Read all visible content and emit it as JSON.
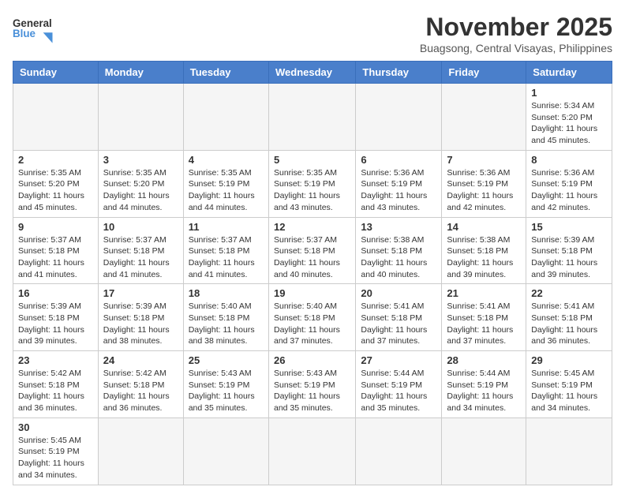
{
  "header": {
    "logo_general": "General",
    "logo_blue": "Blue",
    "month_title": "November 2025",
    "location": "Buagsong, Central Visayas, Philippines"
  },
  "weekdays": [
    "Sunday",
    "Monday",
    "Tuesday",
    "Wednesday",
    "Thursday",
    "Friday",
    "Saturday"
  ],
  "days": [
    {
      "num": "",
      "info": ""
    },
    {
      "num": "",
      "info": ""
    },
    {
      "num": "",
      "info": ""
    },
    {
      "num": "",
      "info": ""
    },
    {
      "num": "",
      "info": ""
    },
    {
      "num": "",
      "info": ""
    },
    {
      "num": "1",
      "info": "Sunrise: 5:34 AM\nSunset: 5:20 PM\nDaylight: 11 hours\nand 45 minutes."
    },
    {
      "num": "2",
      "info": "Sunrise: 5:35 AM\nSunset: 5:20 PM\nDaylight: 11 hours\nand 45 minutes."
    },
    {
      "num": "3",
      "info": "Sunrise: 5:35 AM\nSunset: 5:20 PM\nDaylight: 11 hours\nand 44 minutes."
    },
    {
      "num": "4",
      "info": "Sunrise: 5:35 AM\nSunset: 5:19 PM\nDaylight: 11 hours\nand 44 minutes."
    },
    {
      "num": "5",
      "info": "Sunrise: 5:35 AM\nSunset: 5:19 PM\nDaylight: 11 hours\nand 43 minutes."
    },
    {
      "num": "6",
      "info": "Sunrise: 5:36 AM\nSunset: 5:19 PM\nDaylight: 11 hours\nand 43 minutes."
    },
    {
      "num": "7",
      "info": "Sunrise: 5:36 AM\nSunset: 5:19 PM\nDaylight: 11 hours\nand 42 minutes."
    },
    {
      "num": "8",
      "info": "Sunrise: 5:36 AM\nSunset: 5:19 PM\nDaylight: 11 hours\nand 42 minutes."
    },
    {
      "num": "9",
      "info": "Sunrise: 5:37 AM\nSunset: 5:18 PM\nDaylight: 11 hours\nand 41 minutes."
    },
    {
      "num": "10",
      "info": "Sunrise: 5:37 AM\nSunset: 5:18 PM\nDaylight: 11 hours\nand 41 minutes."
    },
    {
      "num": "11",
      "info": "Sunrise: 5:37 AM\nSunset: 5:18 PM\nDaylight: 11 hours\nand 41 minutes."
    },
    {
      "num": "12",
      "info": "Sunrise: 5:37 AM\nSunset: 5:18 PM\nDaylight: 11 hours\nand 40 minutes."
    },
    {
      "num": "13",
      "info": "Sunrise: 5:38 AM\nSunset: 5:18 PM\nDaylight: 11 hours\nand 40 minutes."
    },
    {
      "num": "14",
      "info": "Sunrise: 5:38 AM\nSunset: 5:18 PM\nDaylight: 11 hours\nand 39 minutes."
    },
    {
      "num": "15",
      "info": "Sunrise: 5:39 AM\nSunset: 5:18 PM\nDaylight: 11 hours\nand 39 minutes."
    },
    {
      "num": "16",
      "info": "Sunrise: 5:39 AM\nSunset: 5:18 PM\nDaylight: 11 hours\nand 39 minutes."
    },
    {
      "num": "17",
      "info": "Sunrise: 5:39 AM\nSunset: 5:18 PM\nDaylight: 11 hours\nand 38 minutes."
    },
    {
      "num": "18",
      "info": "Sunrise: 5:40 AM\nSunset: 5:18 PM\nDaylight: 11 hours\nand 38 minutes."
    },
    {
      "num": "19",
      "info": "Sunrise: 5:40 AM\nSunset: 5:18 PM\nDaylight: 11 hours\nand 37 minutes."
    },
    {
      "num": "20",
      "info": "Sunrise: 5:41 AM\nSunset: 5:18 PM\nDaylight: 11 hours\nand 37 minutes."
    },
    {
      "num": "21",
      "info": "Sunrise: 5:41 AM\nSunset: 5:18 PM\nDaylight: 11 hours\nand 37 minutes."
    },
    {
      "num": "22",
      "info": "Sunrise: 5:41 AM\nSunset: 5:18 PM\nDaylight: 11 hours\nand 36 minutes."
    },
    {
      "num": "23",
      "info": "Sunrise: 5:42 AM\nSunset: 5:18 PM\nDaylight: 11 hours\nand 36 minutes."
    },
    {
      "num": "24",
      "info": "Sunrise: 5:42 AM\nSunset: 5:18 PM\nDaylight: 11 hours\nand 36 minutes."
    },
    {
      "num": "25",
      "info": "Sunrise: 5:43 AM\nSunset: 5:19 PM\nDaylight: 11 hours\nand 35 minutes."
    },
    {
      "num": "26",
      "info": "Sunrise: 5:43 AM\nSunset: 5:19 PM\nDaylight: 11 hours\nand 35 minutes."
    },
    {
      "num": "27",
      "info": "Sunrise: 5:44 AM\nSunset: 5:19 PM\nDaylight: 11 hours\nand 35 minutes."
    },
    {
      "num": "28",
      "info": "Sunrise: 5:44 AM\nSunset: 5:19 PM\nDaylight: 11 hours\nand 34 minutes."
    },
    {
      "num": "29",
      "info": "Sunrise: 5:45 AM\nSunset: 5:19 PM\nDaylight: 11 hours\nand 34 minutes."
    },
    {
      "num": "30",
      "info": "Sunrise: 5:45 AM\nSunset: 5:19 PM\nDaylight: 11 hours\nand 34 minutes."
    },
    {
      "num": "",
      "info": ""
    },
    {
      "num": "",
      "info": ""
    },
    {
      "num": "",
      "info": ""
    },
    {
      "num": "",
      "info": ""
    },
    {
      "num": "",
      "info": ""
    }
  ]
}
